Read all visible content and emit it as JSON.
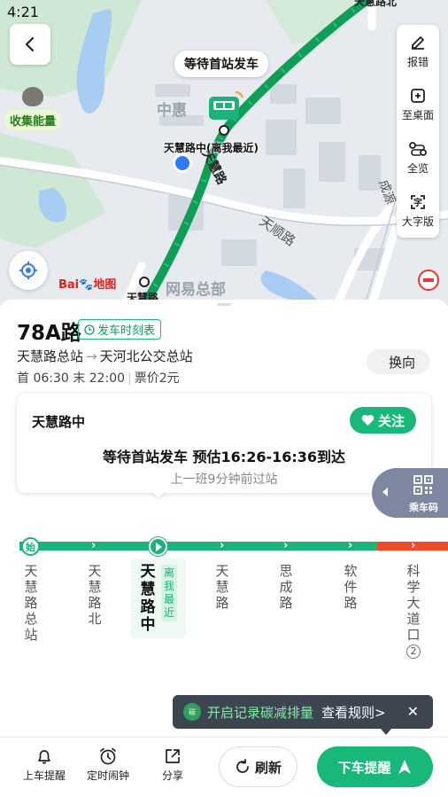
{
  "status_bar": {
    "time": "4:21"
  },
  "map": {
    "status_bubble": "等待首站发车",
    "stop_label": "天慧路中(离我最近)",
    "collect_energy": "收集能量",
    "labels": {
      "zhonghui": "中惠",
      "tianshun": "天顺路",
      "tianhui_vertical": "天慧路",
      "netease": "网易总部",
      "tianhui_north": "天慧路北",
      "tianhui_bottom": "天慧路",
      "chengyuan": "成源"
    },
    "logo": {
      "brand": "Bai",
      "brand2": "地图"
    },
    "tools": [
      {
        "label": "报错",
        "icon": "edit-icon"
      },
      {
        "label": "至桌面",
        "icon": "add-to-desktop-icon"
      },
      {
        "label": "全览",
        "icon": "overview-icon"
      },
      {
        "label": "大字版",
        "icon": "large-font-icon"
      }
    ]
  },
  "route": {
    "name": "78A路",
    "timetable": "发车时刻表",
    "from": "天慧路总站",
    "arrow": "→",
    "to": "天河北公交总站",
    "first": "首 06:30",
    "last_bus": "末 22:00",
    "fare": "票价2元",
    "switch_label": "换向"
  },
  "stop_card": {
    "name": "天慧路中",
    "follow": "关注",
    "arrival": "等待首站发车 预估16:26-16:36到达",
    "last_pass": "上一班9分钟前过站"
  },
  "qr": {
    "label": "乘车码"
  },
  "line": {
    "start_badge": "始",
    "near_badge": "离我最近",
    "stations": [
      {
        "name": "天慧路总站"
      },
      {
        "name": "天慧路北"
      },
      {
        "name": "天慧路中"
      },
      {
        "name": "天慧路"
      },
      {
        "name": "思成路"
      },
      {
        "name": "软件路"
      },
      {
        "name": "科学大道口",
        "subway": "2"
      }
    ]
  },
  "carbon_tip": {
    "icon_text": "碳",
    "text": "开启记录碳减排量",
    "link": "查看规则>",
    "close": "✕"
  },
  "bottom_bar": {
    "board_alert": "上车提醒",
    "alarm": "定时闹钟",
    "share": "分享",
    "refresh": "刷新",
    "alight_alert": "下车提醒"
  },
  "colors": {
    "accent": "#18b87a",
    "line_green": "#1bb37a",
    "line_red": "#ef4a2a",
    "dark_tip": "#3d4650"
  }
}
